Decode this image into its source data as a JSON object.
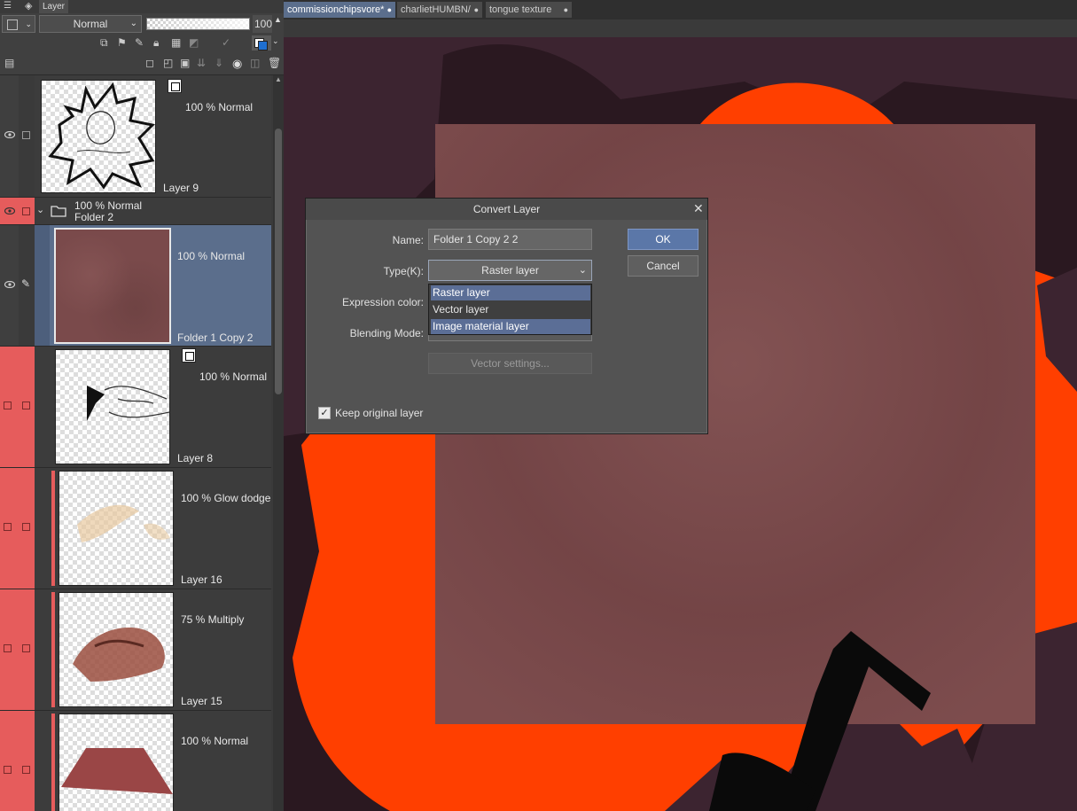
{
  "panel": {
    "title": "Layer",
    "blend_mode": "Normal",
    "opacity": "100"
  },
  "tabs": [
    {
      "label": "commissionchipsvore*",
      "active": true
    },
    {
      "label": "charlietHUMBN/",
      "active": false
    },
    {
      "label": "tongue texture",
      "active": false
    }
  ],
  "layers": [
    {
      "mode": "100 % Normal",
      "name": "Layer 9"
    },
    {
      "mode": "100 % Normal",
      "name": "Folder 2"
    },
    {
      "mode": "100 % Normal",
      "name": "Folder 1 Copy 2"
    },
    {
      "mode": "100 % Normal",
      "name": "Layer 8"
    },
    {
      "mode": "100 % Glow dodge",
      "name": "Layer 16"
    },
    {
      "mode": "75 % Multiply",
      "name": "Layer 15"
    },
    {
      "mode": "100 % Normal",
      "name": ""
    }
  ],
  "dialog": {
    "title": "Convert Layer",
    "name_label": "Name:",
    "name_value": "Folder 1 Copy 2 2",
    "type_label": "Type(K):",
    "type_value": "Raster layer",
    "expression_label": "Expression color:",
    "blending_label": "Blending Mode:",
    "vector_settings": "Vector settings...",
    "keep_original": "Keep original layer",
    "ok": "OK",
    "cancel": "Cancel",
    "type_options": [
      "Raster layer",
      "Vector layer",
      "Image material layer"
    ]
  },
  "colors": {
    "accent": "#5b6e96",
    "selected_layer": "#5b6e8c",
    "layer_color_label": "#e65c5c",
    "canvas_orange": "#ff3f00",
    "texture": "#7a4a4b"
  }
}
